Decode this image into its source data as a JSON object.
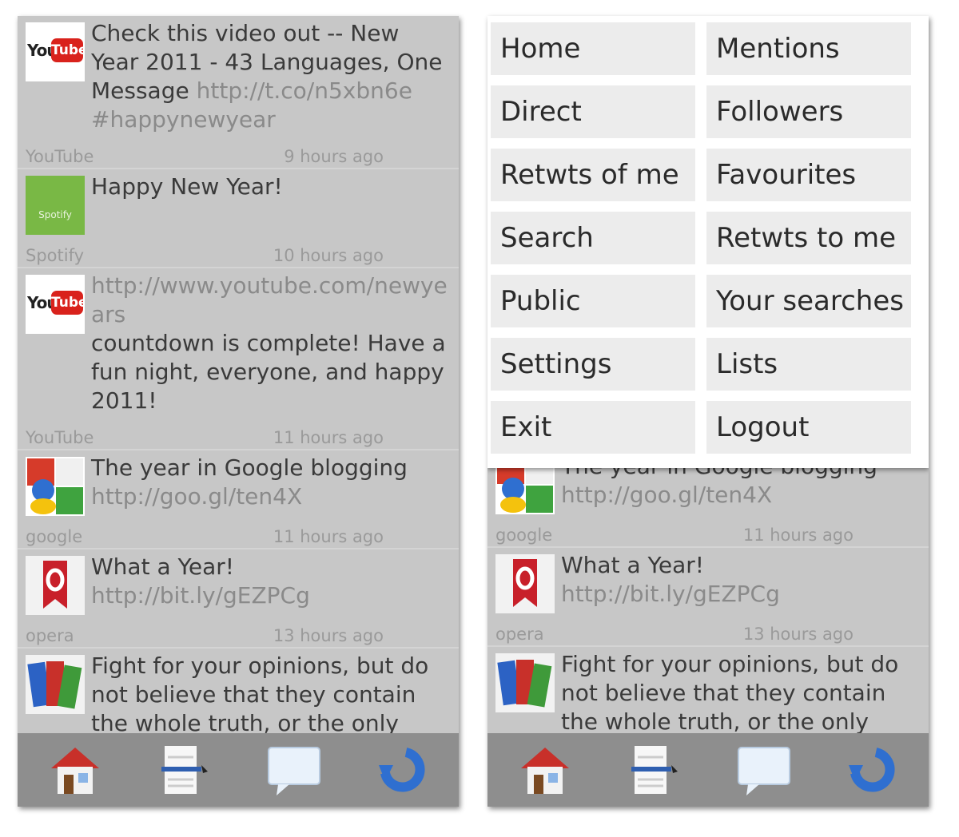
{
  "feed": [
    {
      "text": "Check this video out -- New Year 2011 - 43 Languages, One Message ",
      "link": "http://t.co/n5xbn6e #happynewyear",
      "author": "YouTube",
      "time": "9 hours ago",
      "icon": "youtube-icon",
      "logo_you": "You",
      "logo_tube": "Tube"
    },
    {
      "text": "Happy New Year!",
      "link": "",
      "author": "Spotify",
      "time": "10 hours ago",
      "icon": "spotify-icon",
      "logo_text": "Spotify"
    },
    {
      "text": "countdown is complete! Have a fun night, everyone, and happy 2011!",
      "link": "http://www.youtube.com/newyears",
      "author": "YouTube",
      "time": "11 hours ago",
      "icon": "youtube-icon",
      "logo_you": "You",
      "logo_tube": "Tube"
    },
    {
      "text": "The year in Google blogging",
      "link": "http://goo.gl/ten4X",
      "author": "google",
      "time": "11 hours ago",
      "icon": "google-icon"
    },
    {
      "text": "What a Year!",
      "link": "http://bit.ly/gEZPCg",
      "author": "opera",
      "time": "13 hours ago",
      "icon": "opera-icon"
    },
    {
      "text": "Fight for your opinions, but do not believe that they contain the whole truth, or the only",
      "link": "",
      "author": "",
      "time": "",
      "icon": "books-icon"
    }
  ],
  "right_feed_partial_text": "The year in Google blogging",
  "menu": [
    {
      "label": "Home"
    },
    {
      "label": "Mentions"
    },
    {
      "label": "Direct"
    },
    {
      "label": "Followers"
    },
    {
      "label": "Retwts of me"
    },
    {
      "label": "Favourites"
    },
    {
      "label": "Search"
    },
    {
      "label": "Retwts to me"
    },
    {
      "label": "Public"
    },
    {
      "label": "Your searches"
    },
    {
      "label": "Settings"
    },
    {
      "label": "Lists"
    },
    {
      "label": "Exit"
    },
    {
      "label": "Logout"
    }
  ],
  "toolbar": {
    "icons": [
      "home-icon",
      "compose-icon",
      "message-icon",
      "refresh-icon"
    ]
  },
  "colors": {
    "background": "#c7c7c7",
    "toolbar": "#8e8e8e",
    "menu_item": "#ececec",
    "refresh_blue": "#2f6fd0",
    "youtube_red": "#d9221c",
    "spotify_green": "#79b845"
  }
}
